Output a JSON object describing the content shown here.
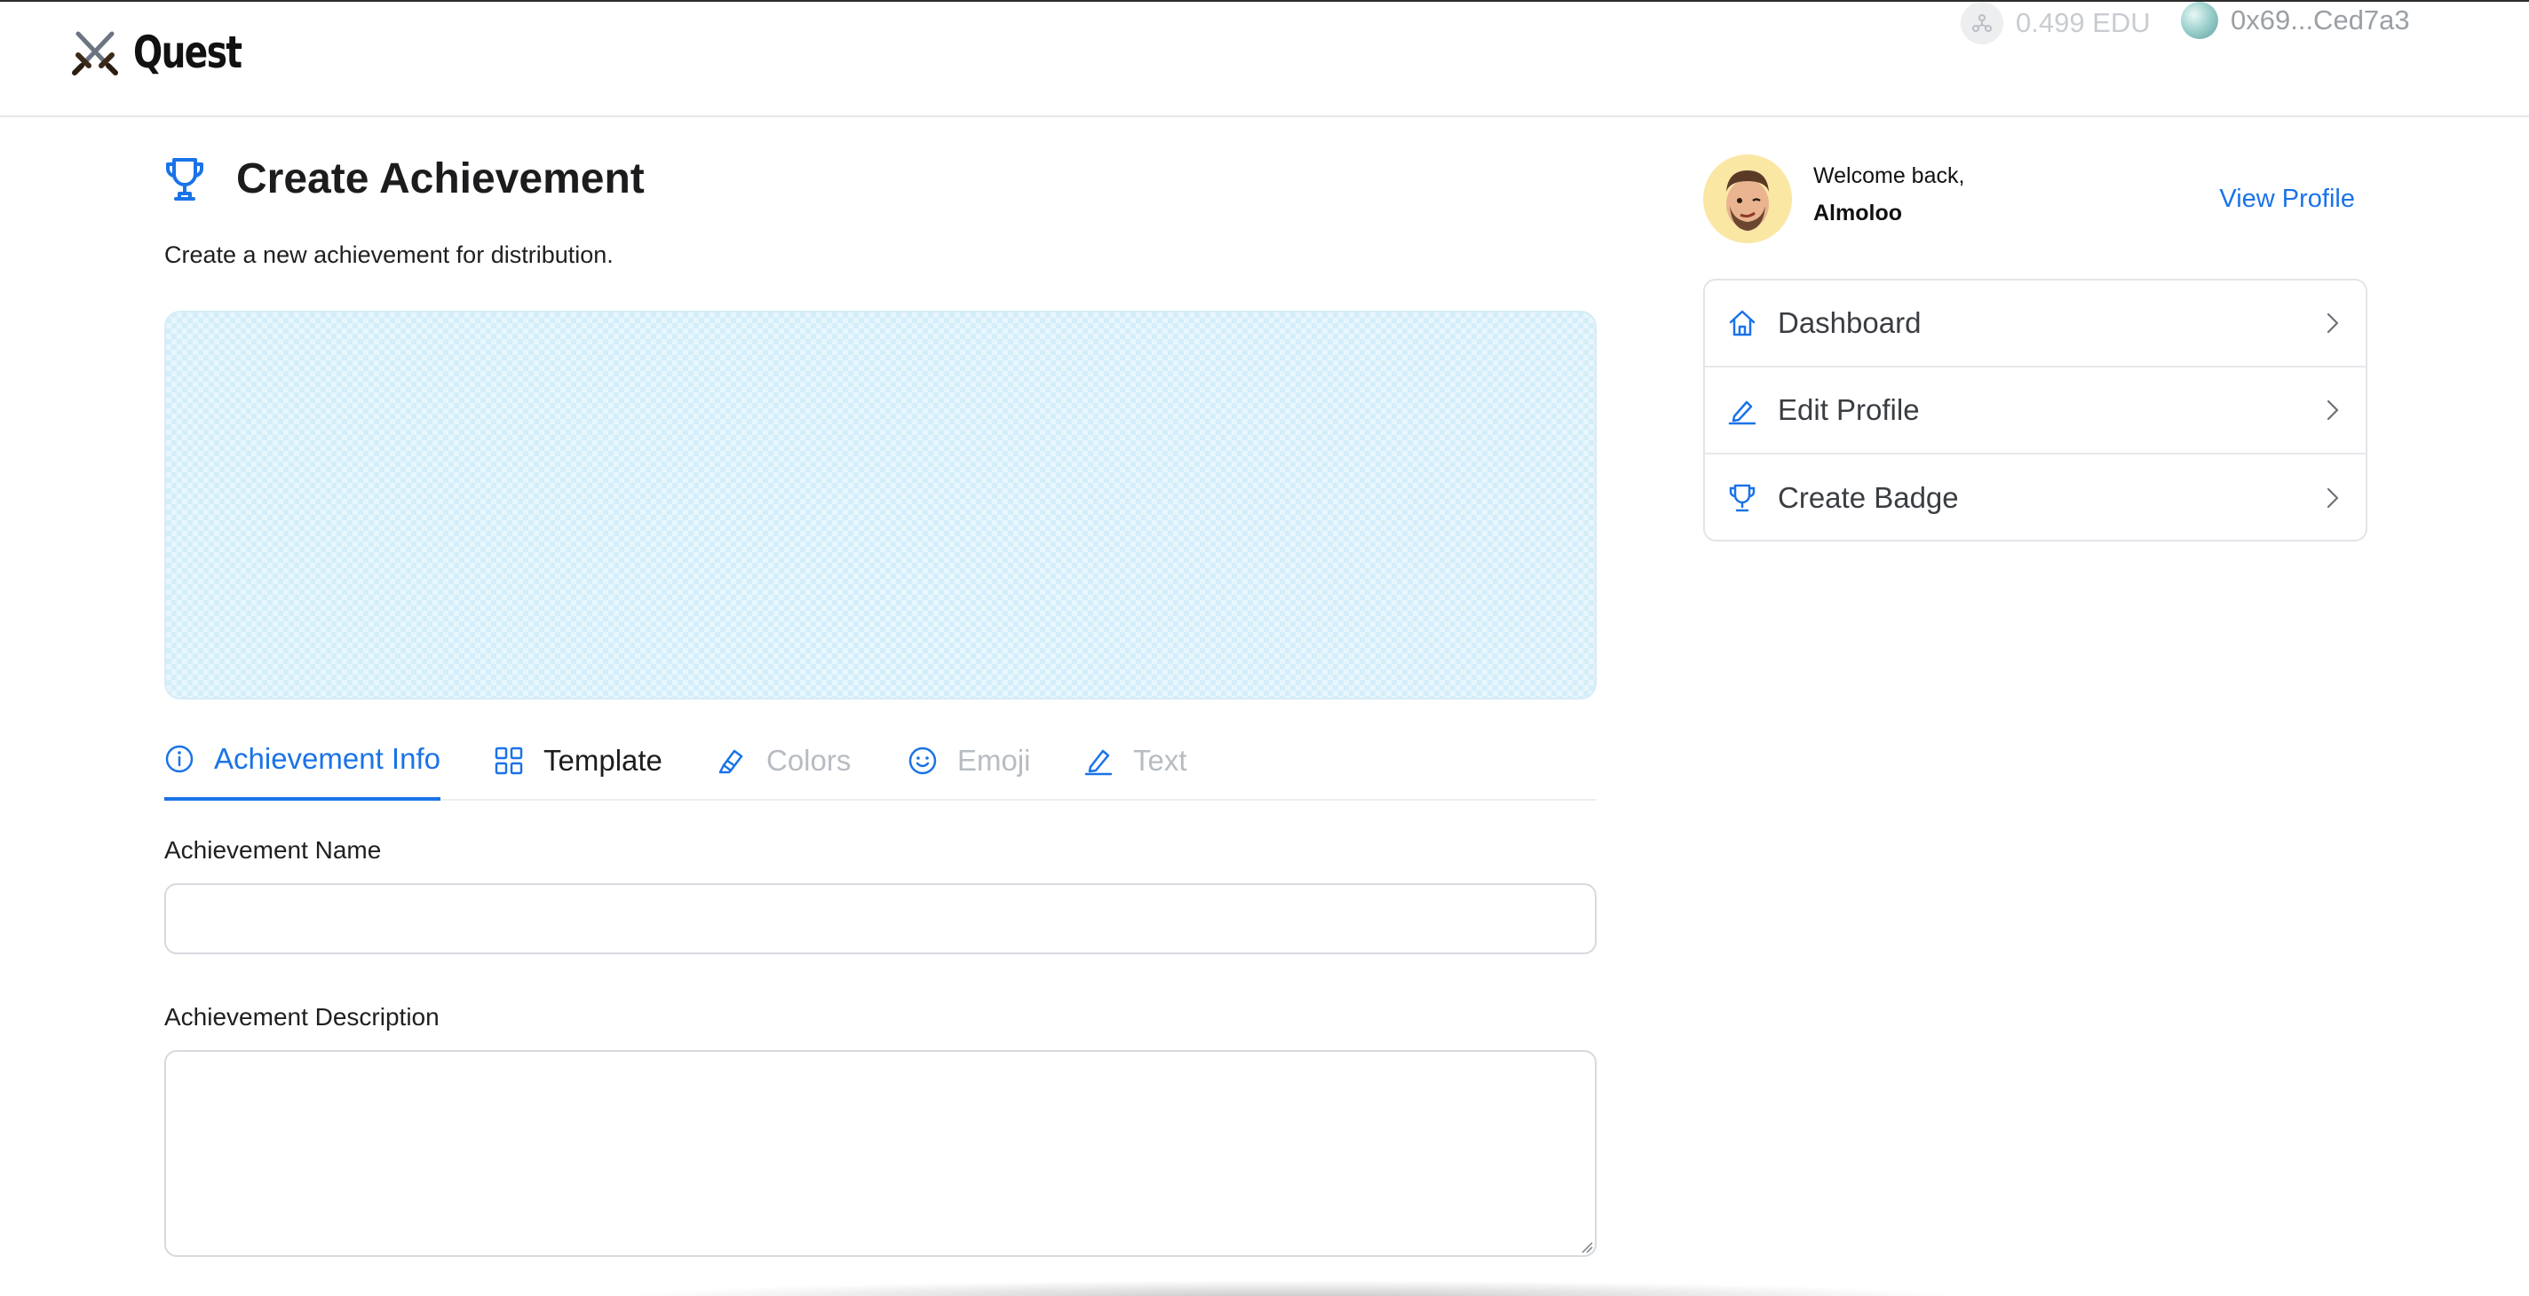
{
  "app": {
    "name": "Quest"
  },
  "header": {
    "balance": "0.499 EDU",
    "wallet_address": "0x69...Ced7a3"
  },
  "page": {
    "title": "Create Achievement",
    "subtitle": "Create a new achievement for distribution."
  },
  "tabs": [
    {
      "label": "Achievement Info",
      "icon": "info-icon",
      "state": "active"
    },
    {
      "label": "Template",
      "icon": "grid-icon",
      "state": "enabled"
    },
    {
      "label": "Colors",
      "icon": "highlighter-icon",
      "state": "disabled"
    },
    {
      "label": "Emoji",
      "icon": "smile-icon",
      "state": "disabled"
    },
    {
      "label": "Text",
      "icon": "pen-icon",
      "state": "disabled"
    }
  ],
  "form": {
    "name_label": "Achievement Name",
    "name_value": "",
    "description_label": "Achievement Description",
    "description_value": ""
  },
  "sidebar": {
    "welcome": "Welcome back,",
    "username": "Almoloo",
    "view_profile": "View Profile",
    "menu": [
      {
        "label": "Dashboard",
        "icon": "home-icon"
      },
      {
        "label": "Edit Profile",
        "icon": "pencil-icon"
      },
      {
        "label": "Create Badge",
        "icon": "trophy-icon"
      }
    ]
  },
  "colors": {
    "accent": "#1a73e8",
    "preview_bg": "#e7f6fd",
    "disabled_text": "#b7bcc2"
  }
}
